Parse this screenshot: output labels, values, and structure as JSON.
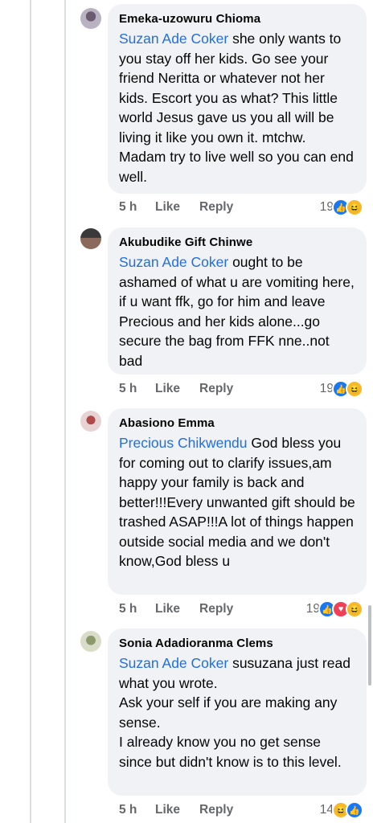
{
  "comments": [
    {
      "author": "Emeka-uzowuru Chioma",
      "mention": "Suzan Ade Coker",
      "text": " she only wants to you stay off her kids. Go see your friend Neritta or whatever not her kids. Escort you as what? This little world Jesus gave us you all will be living it like you own it. mtchw. Madam try to live well so you can end well.",
      "time": "5 h",
      "like_label": "Like",
      "reply_label": "Reply",
      "reaction_count": "19",
      "reactions": [
        "like",
        "haha"
      ]
    },
    {
      "author": "Akubudike Gift Chinwe",
      "mention": "Suzan Ade Coker",
      "text": " ought to be ashamed of what u are vomiting here, if u want ffk, go for him and leave Precious and her kids alone...go secure the bag from FFK nne..not bad",
      "time": "5 h",
      "like_label": "Like",
      "reply_label": "Reply",
      "reaction_count": "19",
      "reactions": [
        "like",
        "haha"
      ]
    },
    {
      "author": "Abasiono Emma",
      "mention": "Precious Chikwendu",
      "text": " God bless you for coming out to clarify issues,am happy your family is back and better!!!Every unwanted gift should be trashed ASAP!!!A lot of things happen outside social media and we don't know,God bless u",
      "time": "5 h",
      "like_label": "Like",
      "reply_label": "Reply",
      "reaction_count": "19",
      "reactions": [
        "like",
        "love",
        "haha"
      ]
    },
    {
      "author": "Sonia Adadioranma Clems",
      "mention": "Suzan Ade Coker",
      "text": " susuzana just read what you wrote.\nAsk your self if you are making any sense.\nI already know you no get sense since but didn't know is to this level.",
      "time": "5 h",
      "like_label": "Like",
      "reply_label": "Reply",
      "reaction_count": "14",
      "reactions": [
        "haha",
        "like"
      ]
    }
  ],
  "colors": {
    "mention": "#216fdb",
    "bubble": "#f0f2f5",
    "meta": "#65676b"
  }
}
